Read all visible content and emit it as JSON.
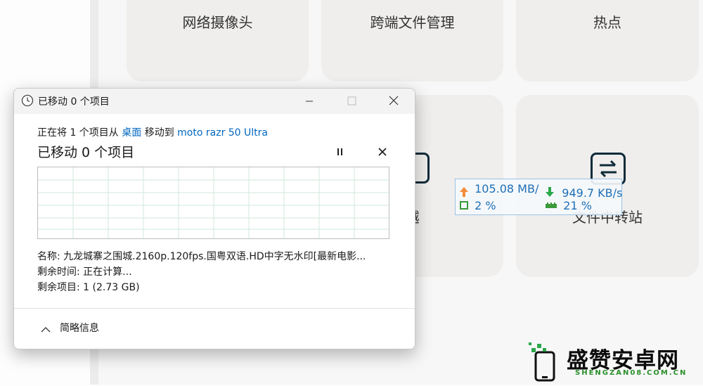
{
  "background_tiles": [
    {
      "label": "网络摄像头"
    },
    {
      "label": "跨端文件管理"
    },
    {
      "label": "热点"
    },
    {
      "label": "穿越"
    },
    {
      "label": "文件中转站"
    }
  ],
  "net_monitor": {
    "upload": "105.08 MB/",
    "download": "949.7 KB/s",
    "cpu": "2 %",
    "memory": "21 %",
    "colors": {
      "upload_arrow": "#f28c3a",
      "download_arrow": "#2aa84a",
      "text": "#1f6fb5"
    }
  },
  "dialog": {
    "title": "已移动 0 个项目",
    "copy_line": {
      "prefix": "正在将 1 个项目从 ",
      "source": "桌面",
      "middle": " 移动到 ",
      "destination": "moto razr 50 Ultra"
    },
    "status_heading": "已移动 0 个项目",
    "details": {
      "name_label": "名称:",
      "name_value": "九龙城寨之围城.2160p.120fps.国粤双语.HD中字无水印[最新电影...",
      "time_label": "剩余时间:",
      "time_value": "正在计算...",
      "items_label": "剩余项目:",
      "items_value": "1 (2.73 GB)"
    },
    "footer_label": "简略信息",
    "accent_color": "#0067c0"
  },
  "watermark": {
    "text": "盛赞安卓网",
    "sub": "SHENGZAN08.COM.CN"
  }
}
